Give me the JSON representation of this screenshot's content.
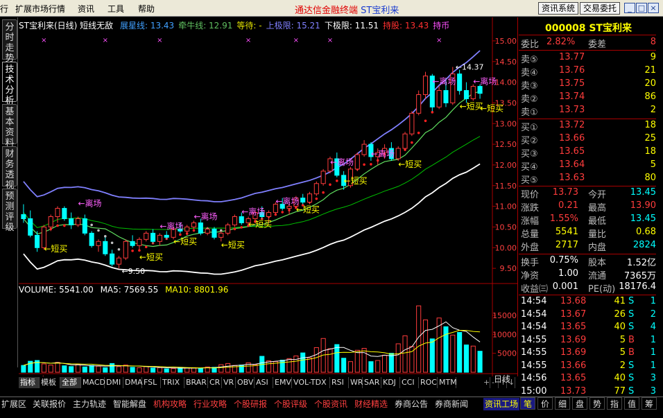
{
  "menu": {
    "cut": "行",
    "items": [
      "扩展市场行情",
      "资讯",
      "工具",
      "帮助"
    ]
  },
  "app": {
    "title": "通达信金融终端",
    "stock": "ST宝利来"
  },
  "top_buttons": [
    "资讯系统",
    "交易委托"
  ],
  "win_buttons": [
    "_",
    "□",
    "×"
  ],
  "left_tabs": [
    "分时走势",
    "技术分析",
    "基本资料",
    "财务透视",
    "预测评级"
  ],
  "chart": {
    "title": "ST宝利来(日线) 短线无敌",
    "legend": [
      {
        "label": "展星线:",
        "value": "13.43",
        "color": "#40a0ff"
      },
      {
        "label": "牵牛线:",
        "value": "12.91",
        "color": "#60c060"
      },
      {
        "label": "等待:",
        "value": "-",
        "color": "#e0e000"
      },
      {
        "label": "上极限:",
        "value": "15.21",
        "color": "#8080ff"
      },
      {
        "label": "下极限:",
        "value": "11.51",
        "color": "#ffffff"
      },
      {
        "label": "持股:",
        "value": "13.43",
        "color": "#ff3030"
      },
      {
        "label": "持币",
        "value": "",
        "color": "#ff50ff"
      }
    ],
    "price_axis": [
      "15.00",
      "14.50",
      "14.00",
      "13.50",
      "13.00",
      "12.50",
      "12.00",
      "11.50",
      "11.00",
      "10.50",
      "10.00",
      "9.50"
    ],
    "vol_axis": [
      "15000",
      "10000",
      "5000"
    ],
    "vol_header": {
      "volume": "VOLUME: 5541.00",
      "ma5": "MA5: 7569.55",
      "ma10": "MA10: 8801.96"
    },
    "annotations": [
      {
        "text": "←短买",
        "x": 8,
        "p": 9.9
      },
      {
        "text": "←离场",
        "x": 19,
        "p": 11.0
      },
      {
        "text": "←短买",
        "x": 39,
        "p": 9.7
      },
      {
        "text": "←离场",
        "x": 48,
        "p": 10.45
      },
      {
        "text": "←短买",
        "x": 51,
        "p": 10.08
      },
      {
        "text": "←离场",
        "x": 59,
        "p": 10.68
      },
      {
        "text": "←短买",
        "x": 68,
        "p": 10.0
      },
      {
        "text": "←离场",
        "x": 75,
        "p": 10.8
      },
      {
        "text": "←短买",
        "x": 78,
        "p": 10.5
      },
      {
        "text": "←离场",
        "x": 86,
        "p": 11.05
      },
      {
        "text": "←短买",
        "x": 93,
        "p": 10.85
      },
      {
        "text": "←离场",
        "x": 107,
        "p": 12.0
      },
      {
        "text": "←短买",
        "x": 111,
        "p": 11.55
      },
      {
        "text": "←离场",
        "x": 119,
        "p": 12.2
      },
      {
        "text": "←短买",
        "x": 129,
        "p": 11.95
      },
      {
        "text": "←离场",
        "x": 141,
        "p": 13.95
      },
      {
        "text": "←短买",
        "x": 151,
        "p": 13.35
      },
      {
        "text": "←离场",
        "x": 155,
        "p": 13.95
      },
      {
        "text": "←短买",
        "x": 159,
        "p": 13.3
      }
    ],
    "hi_label": "14.37",
    "lo_label": "9.50",
    "x_labels": [
      {
        "text": "2012年",
        "x": 0
      },
      {
        "text": "12",
        "x": 30
      },
      {
        "text": "2",
        "x": 116
      },
      {
        "text": "3",
        "x": 150
      }
    ],
    "period": "日线"
  },
  "chart_data": {
    "type": "candlestick",
    "ylim": [
      9.2,
      15.2
    ],
    "ohlc": [
      [
        10.8,
        11.05,
        10.6,
        10.7
      ],
      [
        10.7,
        10.9,
        10.25,
        10.3
      ],
      [
        10.3,
        10.4,
        9.9,
        10.0
      ],
      [
        10.0,
        10.55,
        9.95,
        10.5
      ],
      [
        10.5,
        10.8,
        10.4,
        10.75
      ],
      [
        10.75,
        11.0,
        10.6,
        10.95
      ],
      [
        10.95,
        11.0,
        10.65,
        10.7
      ],
      [
        10.7,
        10.85,
        10.45,
        10.55
      ],
      [
        10.55,
        10.75,
        10.5,
        10.7
      ],
      [
        10.7,
        10.8,
        10.3,
        10.35
      ],
      [
        10.35,
        10.4,
        10.0,
        10.05
      ],
      [
        10.05,
        10.2,
        9.9,
        10.15
      ],
      [
        10.15,
        10.25,
        9.8,
        9.85
      ],
      [
        9.85,
        9.95,
        9.55,
        9.6
      ],
      [
        9.6,
        9.8,
        9.5,
        9.75
      ],
      [
        9.75,
        10.2,
        9.7,
        10.15
      ],
      [
        10.15,
        10.3,
        10.0,
        10.05
      ],
      [
        10.05,
        10.25,
        9.95,
        10.2
      ],
      [
        10.2,
        10.4,
        10.15,
        10.35
      ],
      [
        10.35,
        10.45,
        10.1,
        10.15
      ],
      [
        10.15,
        10.35,
        10.05,
        10.3
      ],
      [
        10.3,
        10.4,
        10.2,
        10.25
      ],
      [
        10.25,
        10.5,
        10.2,
        10.45
      ],
      [
        10.45,
        10.6,
        10.35,
        10.4
      ],
      [
        10.4,
        10.55,
        10.3,
        10.5
      ],
      [
        10.5,
        10.65,
        10.45,
        10.6
      ],
      [
        10.6,
        10.7,
        10.3,
        10.35
      ],
      [
        10.35,
        10.5,
        10.3,
        10.45
      ],
      [
        10.45,
        10.5,
        10.2,
        10.25
      ],
      [
        10.25,
        10.4,
        10.15,
        10.35
      ],
      [
        10.35,
        10.6,
        10.3,
        10.55
      ],
      [
        10.55,
        10.8,
        10.5,
        10.75
      ],
      [
        10.75,
        10.85,
        10.55,
        10.6
      ],
      [
        10.6,
        10.75,
        10.5,
        10.7
      ],
      [
        10.7,
        10.9,
        10.6,
        10.85
      ],
      [
        10.85,
        11.0,
        10.7,
        10.75
      ],
      [
        10.75,
        10.9,
        10.6,
        10.85
      ],
      [
        10.85,
        11.1,
        10.8,
        11.05
      ],
      [
        11.05,
        11.2,
        10.9,
        10.95
      ],
      [
        10.95,
        11.05,
        10.8,
        11.0
      ],
      [
        11.0,
        11.25,
        10.95,
        11.2
      ],
      [
        11.2,
        11.3,
        11.05,
        11.1
      ],
      [
        11.1,
        11.35,
        11.05,
        11.3
      ],
      [
        11.3,
        11.6,
        11.25,
        11.55
      ],
      [
        11.55,
        11.9,
        11.5,
        11.85
      ],
      [
        11.85,
        12.2,
        11.8,
        12.15
      ],
      [
        12.15,
        12.3,
        11.7,
        11.75
      ],
      [
        11.75,
        11.85,
        11.4,
        11.5
      ],
      [
        11.5,
        11.95,
        11.45,
        11.9
      ],
      [
        11.9,
        12.3,
        11.85,
        12.25
      ],
      [
        12.25,
        12.6,
        12.2,
        12.5
      ],
      [
        12.5,
        12.55,
        12.1,
        12.2
      ],
      [
        12.2,
        12.4,
        12.0,
        12.3
      ],
      [
        12.3,
        12.5,
        12.15,
        12.4
      ],
      [
        12.4,
        12.55,
        12.1,
        12.15
      ],
      [
        12.15,
        12.45,
        12.1,
        12.4
      ],
      [
        12.4,
        12.8,
        12.35,
        12.75
      ],
      [
        12.75,
        13.3,
        12.7,
        13.25
      ],
      [
        13.25,
        13.8,
        13.2,
        13.7
      ],
      [
        13.7,
        14.25,
        13.6,
        14.15
      ],
      [
        14.15,
        14.2,
        13.3,
        13.4
      ],
      [
        13.4,
        13.9,
        13.35,
        13.8
      ],
      [
        13.8,
        14.1,
        13.4,
        13.5
      ],
      [
        13.5,
        14.37,
        13.45,
        14.2
      ],
      [
        14.2,
        14.3,
        13.7,
        13.8
      ],
      [
        13.8,
        14.0,
        13.5,
        13.6
      ],
      [
        13.6,
        13.95,
        13.55,
        13.9
      ],
      [
        13.9,
        13.95,
        13.6,
        13.73
      ]
    ],
    "volume": [
      1800,
      2900,
      3100,
      2200,
      1900,
      2600,
      1700,
      1500,
      2100,
      1400,
      1800,
      1600,
      1200,
      2300,
      1500,
      1900,
      1300,
      1200,
      1500,
      1100,
      1200,
      900,
      1000,
      1300,
      1100,
      1200,
      1000,
      1400,
      1300,
      2000,
      2300,
      1800,
      1900,
      2500,
      2000,
      4200,
      3000,
      2800,
      3200,
      3600,
      4300,
      5100,
      3800,
      6500,
      8900,
      6200,
      7300,
      3700,
      2800,
      5800,
      6300,
      2800,
      3100,
      4500,
      5000,
      7500,
      9600,
      6800,
      17500,
      13800,
      8800,
      14300,
      12000,
      9800,
      10500,
      7200,
      6900,
      5541
    ]
  },
  "quote": {
    "code_name": "000008 ST宝利来",
    "weibi": {
      "label": "委比",
      "pct": "2.82%",
      "label2": "委差",
      "val": "8"
    },
    "asks": [
      {
        "label": "卖⑤",
        "price": "13.77",
        "vol": "9"
      },
      {
        "label": "卖④",
        "price": "13.76",
        "vol": "21"
      },
      {
        "label": "卖③",
        "price": "13.75",
        "vol": "20"
      },
      {
        "label": "卖②",
        "price": "13.74",
        "vol": "86"
      },
      {
        "label": "卖①",
        "price": "13.73",
        "vol": "2"
      }
    ],
    "bids": [
      {
        "label": "买①",
        "price": "13.72",
        "vol": "18"
      },
      {
        "label": "买②",
        "price": "13.66",
        "vol": "25"
      },
      {
        "label": "买③",
        "price": "13.65",
        "vol": "18"
      },
      {
        "label": "买④",
        "price": "13.64",
        "vol": "5"
      },
      {
        "label": "买⑤",
        "price": "13.63",
        "vol": "80"
      }
    ],
    "stats": [
      {
        "l1": "现价",
        "v1": "13.73",
        "l2": "今开",
        "v2": "13.45"
      },
      {
        "l1": "涨跌",
        "v1": "0.21",
        "l2": "最高",
        "v2": "13.90"
      },
      {
        "l1": "涨幅",
        "v1": "1.55%",
        "l2": "最低",
        "v2": "13.45"
      },
      {
        "l1": "总量",
        "v1": "5541",
        "l2": "量比",
        "v2": "0.68"
      },
      {
        "l1": "外盘",
        "v1": "2717",
        "l2": "内盘",
        "v2": "2824"
      }
    ],
    "stats2": [
      {
        "l1": "换手",
        "v1": "0.75%",
        "l2": "股本",
        "v2": "1.52亿"
      },
      {
        "l1": "净资",
        "v1": "1.00",
        "l2": "流通",
        "v2": "7365万"
      },
      {
        "l1": "收益㈢",
        "v1": "0.001",
        "l2": "PE(动)",
        "v2": "18176.4"
      }
    ],
    "ticks": [
      {
        "t": "14:54",
        "p": "13.68",
        "v": "41",
        "s": "S",
        "n": "1"
      },
      {
        "t": "14:54",
        "p": "13.67",
        "v": "26",
        "s": "S",
        "n": "2"
      },
      {
        "t": "14:54",
        "p": "13.65",
        "v": "40",
        "s": "S",
        "n": "4"
      },
      {
        "t": "14:55",
        "p": "13.69",
        "v": "5",
        "s": "B",
        "n": "1"
      },
      {
        "t": "14:55",
        "p": "13.69",
        "v": "5",
        "s": "B",
        "n": "1"
      },
      {
        "t": "14:55",
        "p": "13.66",
        "v": "2",
        "s": "S",
        "n": "1"
      },
      {
        "t": "14:56",
        "p": "13.65",
        "v": "40",
        "s": "S",
        "n": "3"
      },
      {
        "t": "15:00",
        "p": "13.73",
        "v": "77",
        "s": "S",
        "n": "3"
      }
    ]
  },
  "indicators": [
    "指标",
    "模板",
    "全部",
    "MACD",
    "DMI",
    "DMA",
    "FSL",
    "TRIX",
    "BRAR",
    "CR",
    "VR",
    "OBV",
    "ASI",
    "EMV",
    "VOL-TDX",
    "RSI",
    "WR",
    "SAR",
    "KDJ",
    "CCI",
    "ROC",
    "MTM",
    "BOLL",
    "PSY"
  ],
  "scroll_btns": [
    "+",
    "-",
    "↑",
    "↓"
  ],
  "bottom_tabs": [
    "扩展区",
    "关联报价",
    "主力轨迹",
    "智能解盘",
    "机构攻略",
    "行业攻略",
    "个股研报",
    "个股评级",
    "个股资讯",
    "财经精选",
    "券商公告",
    "券商新闻",
    "资讯工场"
  ],
  "right_tabs": [
    "笔",
    "价",
    "细",
    "盘",
    "势",
    "指",
    "值",
    "筹"
  ]
}
